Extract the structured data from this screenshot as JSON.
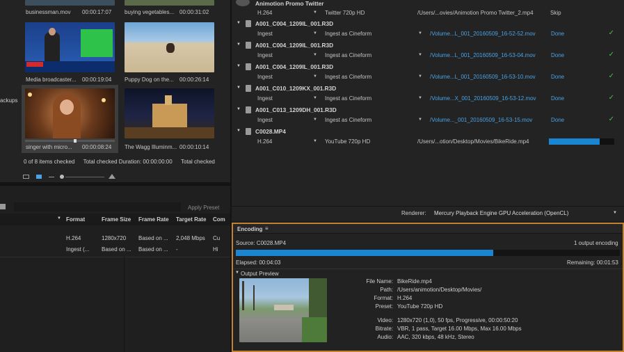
{
  "media_browser": {
    "items": [
      {
        "label": "businessman.mov",
        "duration": "00:00:17:07"
      },
      {
        "label": "buying vegetables...",
        "duration": "00:00:31:02"
      },
      {
        "label": "Media broadcaster...",
        "duration": "00:00:19:04"
      },
      {
        "label": "Puppy Dog on the...",
        "duration": "00:00:26:14"
      },
      {
        "label": "singer with micro...",
        "duration": "00:00:08:24"
      },
      {
        "label": "The Wagg Illuminm...",
        "duration": "00:00:10:14"
      }
    ],
    "side_label": "ackups",
    "status": {
      "checked": "0 of 8 items checked",
      "duration_label": "Total checked Duration: 00:00:00:00",
      "duration_label_2": "Total checked"
    }
  },
  "preset_browser": {
    "apply_button": "Apply Preset",
    "columns": [
      "Format",
      "Frame Size",
      "Frame Rate",
      "Target Rate",
      "Com"
    ],
    "rows": [
      [
        "H.264",
        "1280x720",
        "Based on ...",
        "2,048 Mbps",
        "Cu"
      ],
      [
        "Ingest (...",
        "Based on ...",
        "Based on ...",
        "-",
        "Hi"
      ]
    ]
  },
  "queue": {
    "top_title": "Animotion Promo Twitter",
    "top_output": {
      "format": "H.264",
      "preset": "Twitter 720p HD",
      "path": "/Users/...ovies/Animotion Promo Twitter_2.mp4",
      "status": "Skip"
    },
    "sources": [
      {
        "name": "A001_C004_1209IL_001.R3D",
        "format": "Ingest",
        "preset": "Ingest as Cineform",
        "path": "/Volume...L_001_20160509_16-52-52.mov",
        "status": "Done"
      },
      {
        "name": "A001_C004_1209IL_001.R3D",
        "format": "Ingest",
        "preset": "Ingest as Cineform",
        "path": "/Volume...L_001_20160509_16-53-04.mov",
        "status": "Done"
      },
      {
        "name": "A001_C004_1209IL_001.R3D",
        "format": "Ingest",
        "preset": "Ingest as Cineform",
        "path": "/Volume...L_001_20160509_16-53-10.mov",
        "status": "Done"
      },
      {
        "name": "A001_C010_1209KX_001.R3D",
        "format": "Ingest",
        "preset": "Ingest as Cineform",
        "path": "/Volume...X_001_20160509_16-53-12.mov",
        "status": "Done"
      },
      {
        "name": "A001_C013_1209DH_001.R3D",
        "format": "Ingest",
        "preset": "Ingest as Cineform",
        "path": "/Volume..._001_20160509_16-53-15.mov",
        "status": "Done"
      }
    ],
    "last_source": {
      "name": "C0028.MP4",
      "format": "H.264",
      "preset": "YouTube 720p HD",
      "path": "/Users/...otion/Desktop/Movies/BikeRide.mp4",
      "progress": 0.78
    },
    "renderer_label": "Renderer:",
    "renderer_value": "Mercury Playback Engine GPU Acceleration (OpenCL)"
  },
  "encoding": {
    "tab_label": "Encoding",
    "source": "Source: C0028.MP4",
    "output_count": "1 output encoding",
    "elapsed": "Elapsed: 00:04:03",
    "remaining": "Remaining: 00:01:53",
    "progress": 0.67,
    "output_preview": "Output Preview",
    "meta": [
      {
        "label": "File Name:",
        "value": "BikeRide.mp4"
      },
      {
        "label": "Path:",
        "value": "/Users/animotion/Desktop/Movies/"
      },
      {
        "label": "Format:",
        "value": "H.264"
      },
      {
        "label": "Preset:",
        "value": "YouTube 720p HD"
      },
      {
        "label": "Video:",
        "value": "1280x720 (1,0), 50 fps, Progressive, 00:00:50:20"
      },
      {
        "label": "Bitrate:",
        "value": "VBR, 1 pass, Target 16.00 Mbps, Max 16.00 Mbps"
      },
      {
        "label": "Audio:",
        "value": "AAC, 320 kbps, 48 kHz, Stereo"
      }
    ]
  },
  "colors": {
    "accent_blue": "#1a85d0",
    "done_green": "#45c24a",
    "border_orange": "#c3822f",
    "link_blue": "#4aa3e6"
  }
}
